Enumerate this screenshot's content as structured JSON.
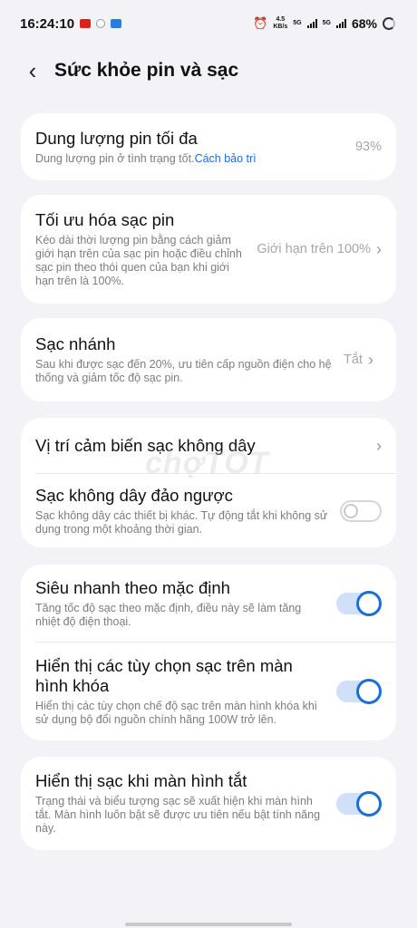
{
  "status": {
    "time": "16:24:10",
    "net_speed_top": "4.5",
    "net_speed_bottom": "KB/s",
    "net1": "5G",
    "net2": "5G",
    "battery": "68%"
  },
  "header": {
    "title": "Sức khỏe pin và sạc"
  },
  "cards": {
    "max_capacity": {
      "title": "Dung lượng pin tối đa",
      "subtitle": "Dung lượng pin ở tình trạng tốt.",
      "link": "Cách bảo trì",
      "value": "93%"
    },
    "optimize": {
      "title": "Tối ưu hóa sạc pin",
      "subtitle": "Kéo dài thời lượng pin bằng cách giảm giới hạn trên của sạc pin hoặc điều chỉnh sạc pin theo thói quen của bạn khi giới hạn trên là 100%.",
      "value": "Giới hạn trên 100%"
    },
    "fast": {
      "title": "Sạc nhánh",
      "subtitle": "Sau khi được sạc đến 20%, ưu tiên cấp nguồn điện cho hệ thống và giảm tốc độ sạc pin.",
      "value": "Tắt"
    },
    "wireless_sensor": {
      "title": "Vị trí cảm biến sạc không dây"
    },
    "reverse_wireless": {
      "title": "Sạc không dây đảo ngược",
      "subtitle": "Sạc không dây các thiết bị khác. Tự động tắt khi không sử dụng trong một khoảng thời gian.",
      "enabled": false
    },
    "super_fast": {
      "title": "Siêu nhanh theo mặc định",
      "subtitle": "Tăng tốc độ sạc theo mặc định, điều này sẽ làm tăng nhiệt độ điện thoại.",
      "enabled": true
    },
    "lockscreen_options": {
      "title": "Hiển thị các tùy chọn sạc trên màn hình khóa",
      "subtitle": "Hiển thị các tùy chọn chế độ sạc trên màn hình khóa khi sử dụng bộ đổi nguồn chính hãng 100W trở lên.",
      "enabled": true
    },
    "screen_off": {
      "title": "Hiển thị sạc khi màn hình tắt",
      "subtitle": "Trạng thái và biểu tượng sạc sẽ xuất hiện khi màn hình tắt. Màn hình luôn bật sẽ được ưu tiên nếu bật tính năng này.",
      "enabled": true
    }
  },
  "watermark": "chợTỐT",
  "colors": {
    "accent": "#1a6fd6",
    "background": "#f2f2f7",
    "card": "#ffffff"
  }
}
